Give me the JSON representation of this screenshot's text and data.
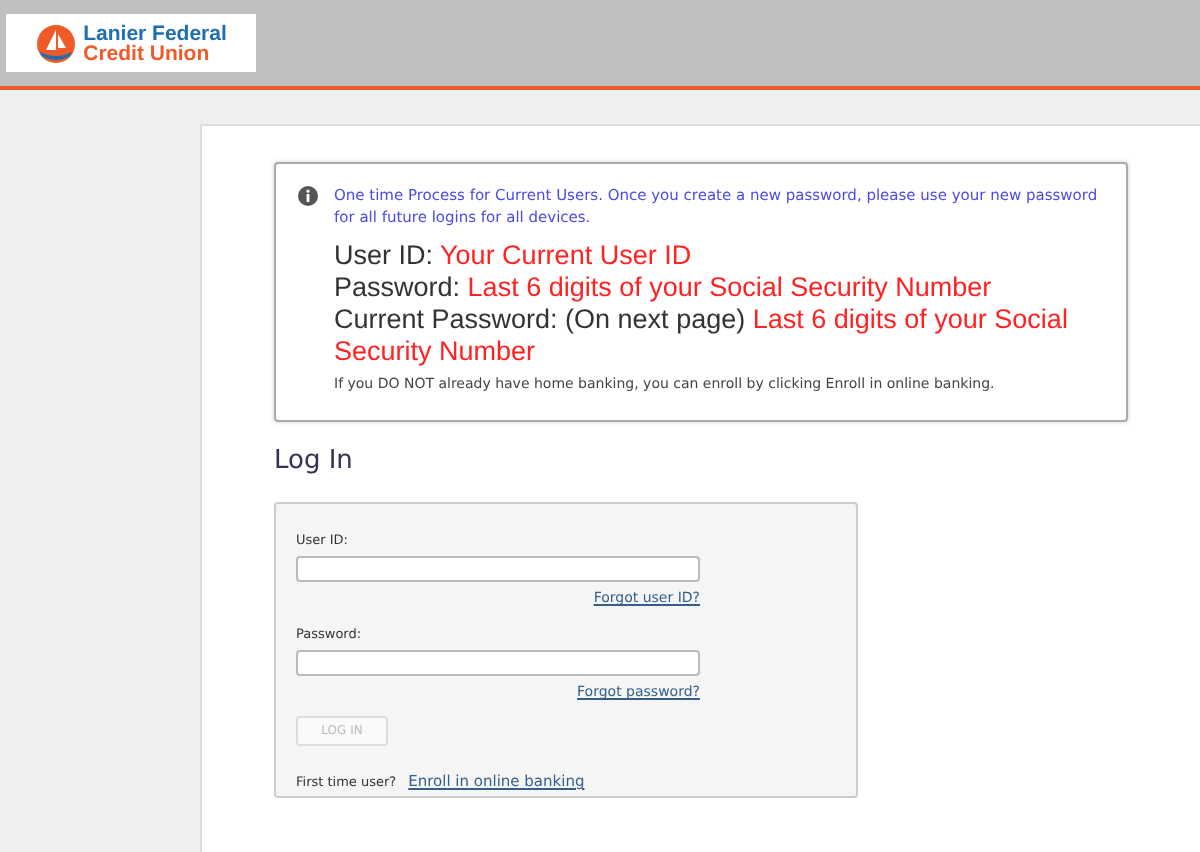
{
  "header": {
    "logo": {
      "line_1": "Lanier Federal",
      "line_2": "Credit Union"
    }
  },
  "notice": {
    "intro": "One time Process for Current Users. Once you create a new password, please use your new password for all future logins for all devices.",
    "lines": [
      {
        "label": "User ID:",
        "value": "Your Current User ID"
      },
      {
        "label": "Password:",
        "value": "Last 6 digits of your Social Security Number"
      },
      {
        "label": "Current Password: (On next page)",
        "value": "Last 6 digits of your Social Security Number"
      }
    ],
    "footer": "If you DO NOT already have home banking, you can enroll by clicking Enroll in online banking."
  },
  "login": {
    "heading": "Log In",
    "fields": [
      {
        "label": "User ID:",
        "link": "Forgot user ID?"
      },
      {
        "label": "Password:",
        "link": "Forgot password?"
      }
    ],
    "button": {
      "label": "LOG IN",
      "disabled": true
    },
    "first_time": {
      "text": "First time user?",
      "link": "Enroll in online banking"
    }
  }
}
